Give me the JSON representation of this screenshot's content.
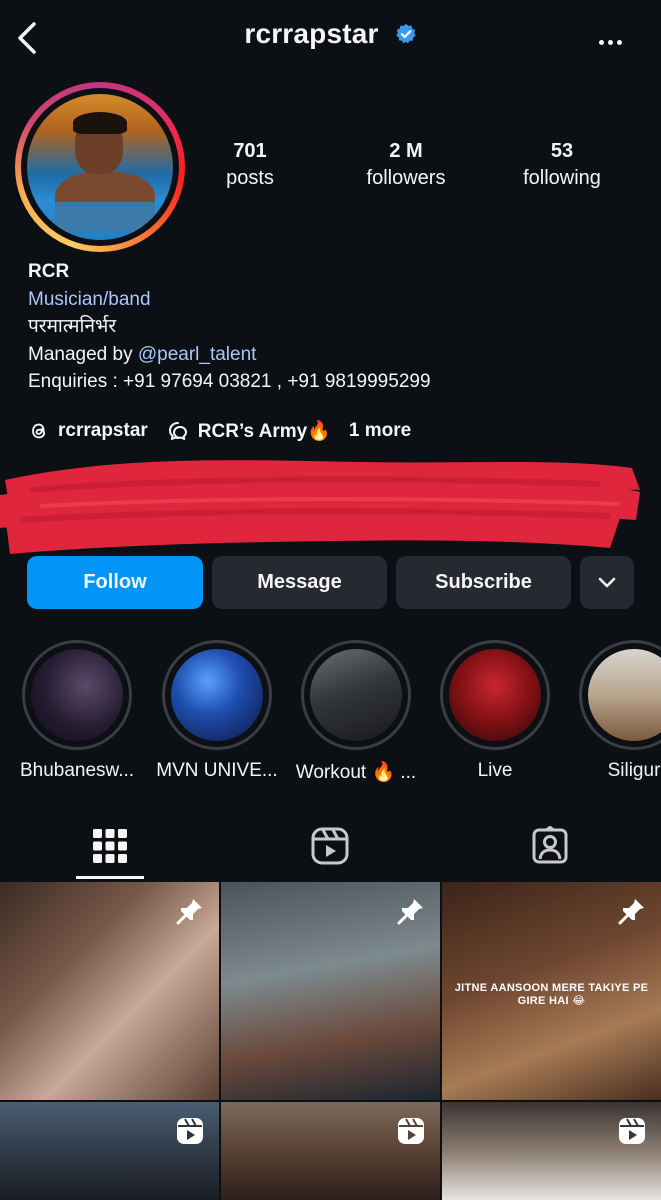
{
  "header": {
    "username": "rcrrapstar"
  },
  "stats": [
    {
      "num": "701",
      "label": "posts"
    },
    {
      "num": "2 M",
      "label": "followers"
    },
    {
      "num": "53",
      "label": "following"
    }
  ],
  "bio": {
    "name": "RCR",
    "category": "Musician/band",
    "line1": "परमात्मनिर्भर",
    "managed_prefix": "Managed by ",
    "managed_handle": "@pearl_talent",
    "enquiries": "Enquiries : +91 97694 03821 , +91 9819995299"
  },
  "links": {
    "threads": "rcrrapstar",
    "channel": "RCR’s Army🔥",
    "more": "1 more"
  },
  "buttons": {
    "follow": "Follow",
    "message": "Message",
    "subscribe": "Subscribe"
  },
  "highlights": [
    {
      "label": "Bhubanesw..."
    },
    {
      "label": "MVN UNIVE..."
    },
    {
      "label": "Workout 🔥 ..."
    },
    {
      "label": "Live"
    },
    {
      "label": "Siligur"
    }
  ],
  "posts": {
    "overlay_text": "JITNE AANSOON MERE TAKIYE PE GIRE HAI 😂"
  },
  "colors": {
    "background": "#0c1014",
    "accent": "#0095f6",
    "link": "#a8c7fa",
    "button": "#262a30"
  }
}
